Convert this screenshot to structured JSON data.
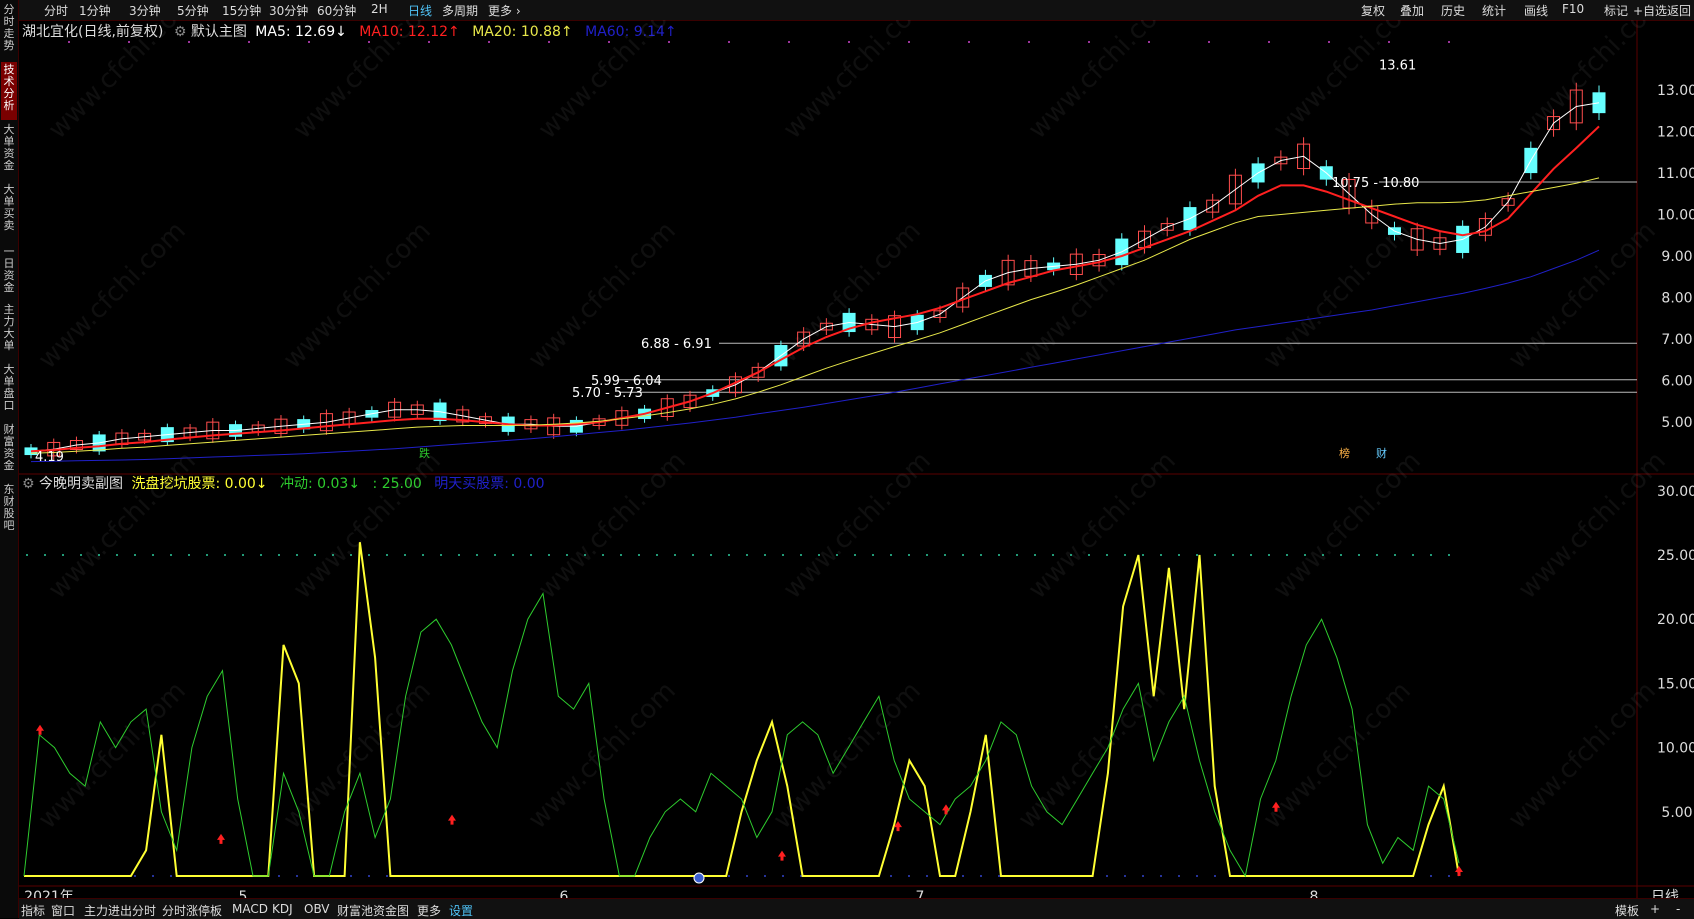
{
  "left_tabs": [
    "分时走势",
    "技术分析",
    "大单资金",
    "大单买卖",
    "一日资金",
    "主力大单",
    "大单盘口",
    "财富资金",
    "东财股吧"
  ],
  "top_tabs": [
    "分时",
    "1分钟",
    "3分钟",
    "5分钟",
    "15分钟",
    "30分钟",
    "60分钟",
    "2H",
    "日线",
    "多周期",
    "更多 ›"
  ],
  "top_right": [
    "复权",
    "叠加",
    "历史",
    "统计",
    "画线",
    "F10",
    "标记",
    "+自选",
    "返回"
  ],
  "main_title": {
    "stock": "湖北宜化(日线,前复权)",
    "chart_name": "默认主图",
    "ma5": "MA5: 12.69↓",
    "ma10": "MA10: 12.12↑",
    "ma20": "MA20: 10.88↑",
    "ma60": "MA60: 9.14↑"
  },
  "sub_title": {
    "name": "今晚明卖副图",
    "s1": "洗盘挖坑股票: 0.00↓",
    "s2": "冲动: 0.03↓",
    "s3": ": 25.00",
    "s4": "明天买股票: 0.00"
  },
  "bottom_tabs": [
    "指标",
    "窗口",
    "主力进出分时",
    "分时涨停板",
    "MACD",
    "KDJ",
    "OBV",
    "财富池资金图",
    "更多",
    "设置"
  ],
  "bottom_right": [
    "模板",
    "+",
    "-"
  ],
  "period_label": "日线",
  "watermark": "www.cfchi.com",
  "colors": {
    "up": "#ff4d4d",
    "down": "#66ffff",
    "ma5": "#ffffff",
    "ma10": "#ff2020",
    "ma20": "#e8e84a",
    "ma60": "#2020c8",
    "green": "#2ecc2e",
    "yellow": "#ffff33"
  },
  "chart_data": [
    {
      "type": "candlestick",
      "price_axis": {
        "ticks": [
          "13.00",
          "12.00",
          "11.00",
          "10.00",
          "9.00",
          "8.00",
          "7.00",
          "6.00",
          "5.00"
        ],
        "range": [
          3.8,
          14.2
        ]
      },
      "date_axis": [
        "2021年",
        "5",
        "6",
        "7",
        "8"
      ],
      "annotations": [
        {
          "text": "4.19",
          "price": 4.19
        },
        {
          "text": "5.70 - 5.73",
          "price": 5.72
        },
        {
          "text": "5.99 - 6.04",
          "price": 6.02
        },
        {
          "text": "6.88 - 6.91",
          "price": 6.9
        },
        {
          "text": "10.75 - 10.80",
          "price": 10.78
        },
        {
          "text": "13.61",
          "price": 13.61
        }
      ],
      "markers": [
        "跌",
        "榜",
        "财"
      ],
      "series": [
        {
          "name": "MA5",
          "values": [
            4.3,
            4.35,
            4.45,
            4.5,
            4.6,
            4.65,
            4.7,
            4.75,
            4.8,
            4.8,
            4.85,
            4.9,
            4.95,
            5.0,
            5.1,
            5.2,
            5.3,
            5.3,
            5.25,
            5.15,
            5.05,
            4.95,
            4.95,
            4.9,
            4.9,
            5.0,
            5.1,
            5.2,
            5.35,
            5.5,
            5.7,
            5.9,
            6.2,
            6.6,
            7.0,
            7.3,
            7.4,
            7.35,
            7.3,
            7.4,
            7.6,
            8.0,
            8.4,
            8.6,
            8.7,
            8.75,
            8.8,
            8.9,
            9.1,
            9.4,
            9.7,
            9.9,
            10.2,
            10.6,
            11.0,
            11.3,
            11.4,
            11.0,
            10.5,
            10.0,
            9.6,
            9.4,
            9.3,
            9.4,
            9.7,
            10.3,
            11.3,
            12.2,
            12.6,
            12.69
          ]
        },
        {
          "name": "MA10",
          "values": [
            4.3,
            4.33,
            4.38,
            4.42,
            4.48,
            4.52,
            4.58,
            4.63,
            4.68,
            4.72,
            4.76,
            4.8,
            4.85,
            4.9,
            4.95,
            5.0,
            5.05,
            5.08,
            5.08,
            5.05,
            5.0,
            4.95,
            4.92,
            4.92,
            4.95,
            5.0,
            5.1,
            5.2,
            5.35,
            5.5,
            5.7,
            5.95,
            6.2,
            6.5,
            6.8,
            7.05,
            7.25,
            7.4,
            7.5,
            7.6,
            7.75,
            7.95,
            8.15,
            8.35,
            8.5,
            8.65,
            8.75,
            8.85,
            9.0,
            9.2,
            9.4,
            9.6,
            9.85,
            10.1,
            10.45,
            10.7,
            10.7,
            10.55,
            10.35,
            10.15,
            9.95,
            9.75,
            9.6,
            9.5,
            9.6,
            9.9,
            10.5,
            11.1,
            11.6,
            12.12
          ]
        },
        {
          "name": "MA20",
          "values": [
            4.25,
            4.27,
            4.3,
            4.33,
            4.37,
            4.4,
            4.44,
            4.48,
            4.52,
            4.56,
            4.6,
            4.64,
            4.68,
            4.72,
            4.76,
            4.8,
            4.84,
            4.88,
            4.9,
            4.92,
            4.92,
            4.92,
            4.93,
            4.95,
            4.98,
            5.02,
            5.08,
            5.15,
            5.23,
            5.32,
            5.43,
            5.56,
            5.72,
            5.9,
            6.1,
            6.3,
            6.48,
            6.65,
            6.82,
            6.98,
            7.15,
            7.35,
            7.55,
            7.75,
            7.95,
            8.12,
            8.3,
            8.5,
            8.7,
            8.9,
            9.15,
            9.4,
            9.6,
            9.8,
            9.95,
            10.0,
            10.05,
            10.1,
            10.15,
            10.2,
            10.25,
            10.28,
            10.28,
            10.3,
            10.35,
            10.45,
            10.55,
            10.65,
            10.75,
            10.88
          ]
        },
        {
          "name": "MA60",
          "values": [
            4.05,
            4.06,
            4.07,
            4.08,
            4.09,
            4.1,
            4.12,
            4.14,
            4.16,
            4.18,
            4.2,
            4.22,
            4.24,
            4.27,
            4.3,
            4.33,
            4.36,
            4.4,
            4.44,
            4.48,
            4.52,
            4.56,
            4.6,
            4.65,
            4.7,
            4.75,
            4.8,
            4.86,
            4.92,
            4.98,
            5.05,
            5.12,
            5.2,
            5.28,
            5.36,
            5.45,
            5.54,
            5.63,
            5.72,
            5.82,
            5.92,
            6.02,
            6.12,
            6.22,
            6.32,
            6.42,
            6.52,
            6.62,
            6.72,
            6.82,
            6.92,
            7.02,
            7.12,
            7.22,
            7.3,
            7.38,
            7.46,
            7.54,
            7.62,
            7.7,
            7.8,
            7.9,
            8.0,
            8.1,
            8.22,
            8.35,
            8.5,
            8.7,
            8.9,
            9.14
          ]
        }
      ]
    },
    {
      "type": "line",
      "y_axis": {
        "ticks": [
          "30.00",
          "25.00",
          "20.00",
          "15.00",
          "10.00",
          "5.00"
        ],
        "range": [
          0,
          31
        ]
      },
      "reference_line": 25,
      "series": [
        {
          "name": "洗盘挖坑股票",
          "values": [
            0,
            0,
            0,
            0,
            0,
            0,
            0,
            0,
            2,
            11,
            0,
            0,
            0,
            0,
            0,
            0,
            0,
            18,
            15,
            0,
            0,
            0,
            26,
            17,
            0,
            0,
            0,
            0,
            0,
            0,
            0,
            0,
            0,
            0,
            0,
            0,
            0,
            0,
            0,
            0,
            0,
            0,
            0,
            0,
            0,
            0,
            0,
            5,
            9,
            12,
            7,
            0,
            0,
            0,
            0,
            0,
            0,
            4,
            9,
            7,
            0,
            0,
            5,
            11,
            0,
            0,
            0,
            0,
            0,
            0,
            0,
            8,
            21,
            25,
            14,
            24,
            13,
            25,
            7,
            0,
            0,
            0,
            0,
            0,
            0,
            0,
            0,
            0,
            0,
            0,
            0,
            0,
            4,
            7,
            0
          ]
        },
        {
          "name": "冲动",
          "values": [
            0,
            11,
            10,
            8,
            7,
            12,
            10,
            12,
            13,
            5,
            2,
            10,
            14,
            16,
            6,
            0,
            0,
            8,
            5,
            0,
            0,
            5,
            8,
            3,
            6,
            14,
            19,
            20,
            18,
            15,
            12,
            10,
            16,
            20,
            22,
            14,
            13,
            15,
            6,
            0,
            0,
            3,
            5,
            6,
            5,
            8,
            7,
            6,
            3,
            5,
            11,
            12,
            11,
            8,
            10,
            12,
            14,
            9,
            6,
            5,
            4,
            6,
            7,
            9,
            12,
            11,
            7,
            5,
            4,
            6,
            8,
            10,
            13,
            15,
            9,
            12,
            14,
            9,
            5,
            2,
            0,
            6,
            9,
            14,
            18,
            20,
            17,
            13,
            4,
            1,
            3,
            2,
            7,
            6,
            1
          ]
        }
      ]
    }
  ]
}
